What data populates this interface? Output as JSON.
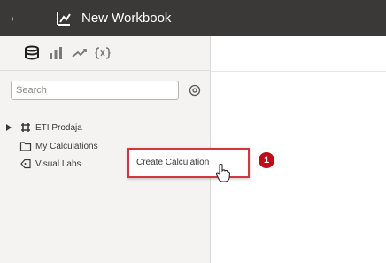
{
  "window": {
    "title": "New Workbook",
    "back_icon": "arrow-left-icon",
    "app_icon": "workbook-icon"
  },
  "left_panel": {
    "tabs": [
      {
        "icon": "data-icon",
        "active": true
      },
      {
        "icon": "visualizations-icon",
        "active": false
      },
      {
        "icon": "analytics-icon",
        "active": false
      },
      {
        "icon": "parameters-icon",
        "active": false
      }
    ],
    "search": {
      "placeholder": "Search",
      "value": ""
    },
    "add_icon": "add-circle-icon",
    "tree": [
      {
        "label": "ETI Prodaja",
        "icon": "dataset-icon",
        "expand_icon": "caret-right-icon"
      },
      {
        "label": "My Calculations",
        "icon": "folder-icon"
      },
      {
        "label": "Visual Labs",
        "icon": "tag-icon"
      }
    ]
  },
  "context_menu": {
    "items": [
      "Create Calculation"
    ]
  },
  "callout": {
    "number": "1"
  },
  "colors": {
    "titlebar": "#3a3937",
    "panel_bg": "#f4f3f2",
    "highlight_border": "#d0373f",
    "badge": "#c00a16"
  }
}
